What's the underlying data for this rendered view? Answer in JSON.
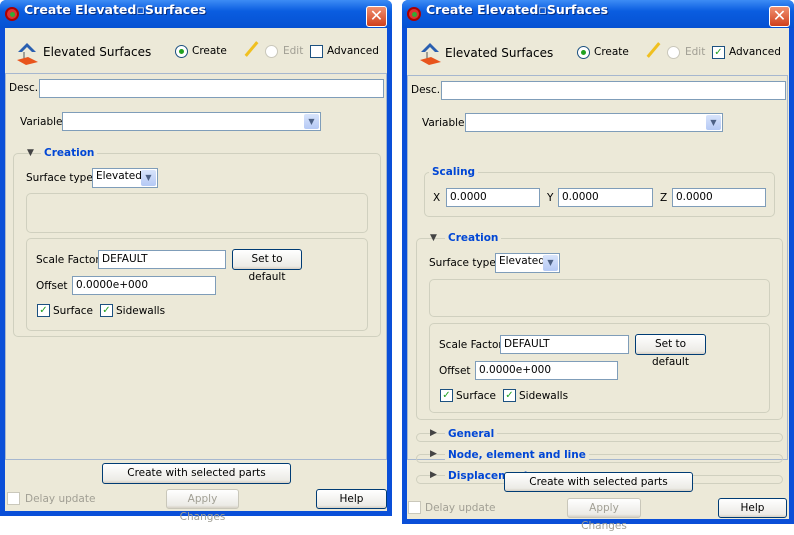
{
  "colors": {
    "title_bar": "#0a5de0",
    "section_header": "#0046d5",
    "panel_bg": "#ece9d8"
  },
  "icons": {
    "app": "ensight-app-icon",
    "header": "elevated-surfaces-icon",
    "edit": "pencil-icon",
    "close": "close-icon",
    "expanded": "triangle-down-icon",
    "collapsed": "triangle-right-icon"
  },
  "windows": [
    {
      "title": "Create Elevated▫Surfaces",
      "header": "Elevated Surfaces",
      "create": "Create",
      "edit": "Edit",
      "advanced": "Advanced",
      "advanced_checked": false,
      "desc_label": "Desc.",
      "desc_value": "",
      "variable_label": "Variable",
      "variable_value": "",
      "creation": "Creation",
      "surface_type_label": "Surface type",
      "surface_type_value": "Elevated",
      "scale_factor_label": "Scale Factor",
      "scale_factor_value": "DEFAULT",
      "set_default": "Set to default",
      "offset_label": "Offset",
      "offset_value": "0.0000e+000",
      "surface": "Surface",
      "sidewalls": "Sidewalls",
      "create_button": "Create with selected parts",
      "delay_update": "Delay update",
      "apply": "Apply Changes",
      "help": "Help"
    },
    {
      "title": "Create Elevated▫Surfaces",
      "header": "Elevated Surfaces",
      "create": "Create",
      "edit": "Edit",
      "advanced": "Advanced",
      "advanced_checked": true,
      "desc_label": "Desc.",
      "desc_value": "",
      "variable_label": "Variable",
      "variable_value": "",
      "scaling": "Scaling",
      "x_label": "X",
      "x_value": "0.0000",
      "y_label": "Y",
      "y_value": "0.0000",
      "z_label": "Z",
      "z_value": "0.0000",
      "creation": "Creation",
      "surface_type_label": "Surface type",
      "surface_type_value": "Elevated",
      "scale_factor_label": "Scale Factor",
      "scale_factor_value": "DEFAULT",
      "set_default": "Set to default",
      "offset_label": "Offset",
      "offset_value": "0.0000e+000",
      "surface": "Surface",
      "sidewalls": "Sidewalls",
      "general": "General",
      "node": "Node, element and line",
      "displacement": "Displacement",
      "create_button": "Create with selected parts",
      "delay_update": "Delay update",
      "apply": "Apply Changes",
      "help": "Help"
    }
  ]
}
